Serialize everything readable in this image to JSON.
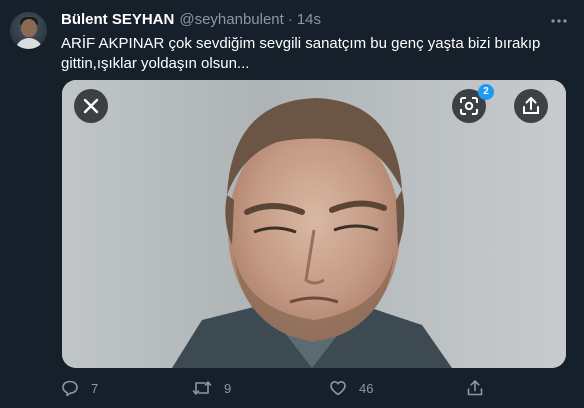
{
  "tweet": {
    "author_name": "Bülent SEYHAN",
    "handle": "@seyhanbulent",
    "separator": "·",
    "timestamp": "14s",
    "text_line1": "ARİF AKPINAR çok sevdiğim sevgili sanatçım bu genç yaşta bizi bırakıp",
    "text_line2": "gittin,ışıklar yoldaşın olsun..."
  },
  "media": {
    "lens_badge_count": "2"
  },
  "actions": {
    "reply_count": "7",
    "retweet_count": "9",
    "like_count": "46"
  },
  "colors": {
    "background": "#15202b",
    "muted": "#8899a6",
    "accent": "#1d9bf0"
  },
  "icons": [
    "more-icon",
    "close-icon",
    "lens-icon",
    "share-icon",
    "reply-icon",
    "retweet-icon",
    "like-icon"
  ]
}
